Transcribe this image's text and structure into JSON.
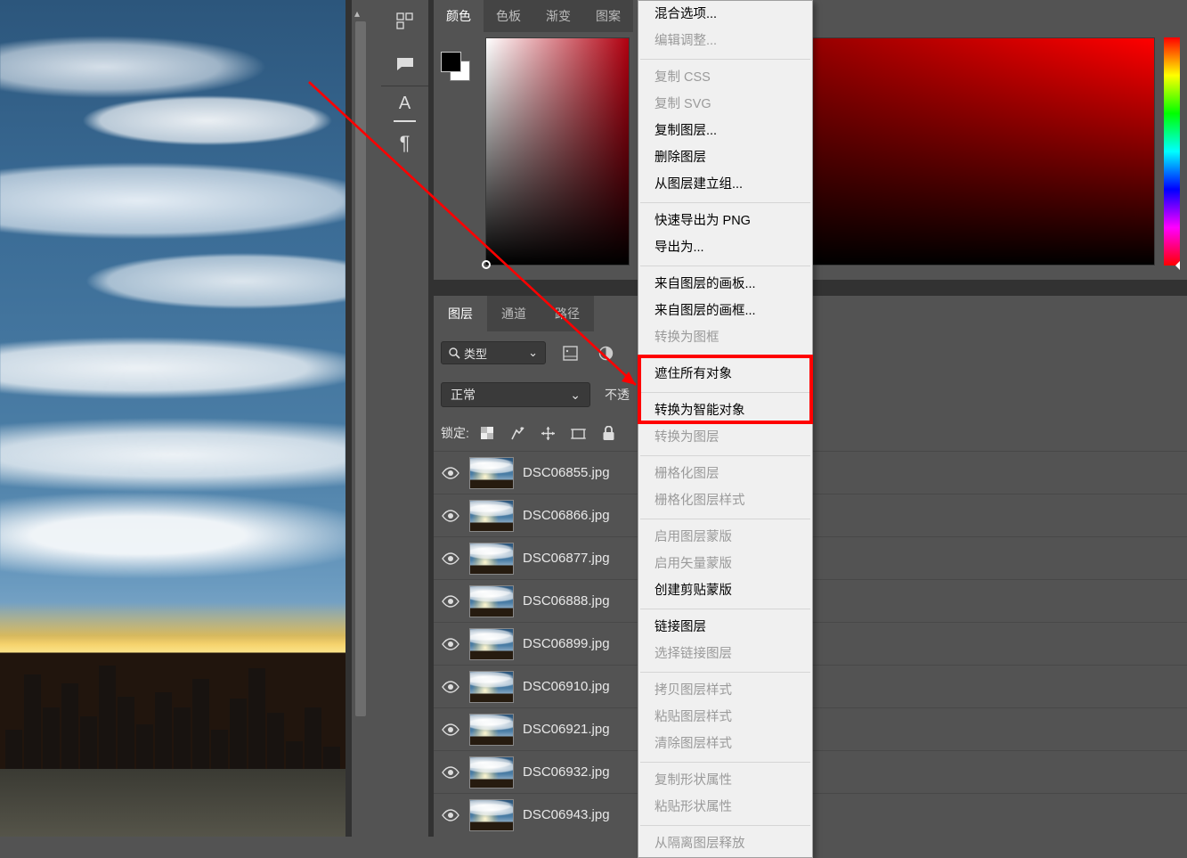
{
  "canvas": {
    "scroll_up_icon": "▴"
  },
  "toolbar_icons": {
    "ruler": "ruler",
    "note": "note",
    "text": "A",
    "paragraph": "¶"
  },
  "color_panel": {
    "tabs": {
      "color": "颜色",
      "swatches": "色板",
      "gradient": "渐变",
      "pattern": "图案"
    },
    "foreground": "#000000",
    "background": "#ffffff"
  },
  "layers_panel": {
    "tabs": {
      "layers": "图层",
      "channels": "通道",
      "paths": "路径"
    },
    "filter": {
      "kind_placeholder": "类型"
    },
    "blend": {
      "mode": "正常",
      "opacity_label": "不透"
    },
    "lock": {
      "label": "锁定:"
    },
    "items": [
      {
        "name": "DSC06855.jpg",
        "visible": true
      },
      {
        "name": "DSC06866.jpg",
        "visible": true
      },
      {
        "name": "DSC06877.jpg",
        "visible": true
      },
      {
        "name": "DSC06888.jpg",
        "visible": true
      },
      {
        "name": "DSC06899.jpg",
        "visible": true
      },
      {
        "name": "DSC06910.jpg",
        "visible": true
      },
      {
        "name": "DSC06921.jpg",
        "visible": true
      },
      {
        "name": "DSC06932.jpg",
        "visible": true
      },
      {
        "name": "DSC06943.jpg",
        "visible": true
      }
    ]
  },
  "context_menu": {
    "groups": [
      [
        {
          "label": "混合选项...",
          "enabled": true
        },
        {
          "label": "编辑调整...",
          "enabled": false
        }
      ],
      [
        {
          "label": "复制 CSS",
          "enabled": false
        },
        {
          "label": "复制 SVG",
          "enabled": false
        },
        {
          "label": "复制图层...",
          "enabled": true
        },
        {
          "label": "删除图层",
          "enabled": true
        },
        {
          "label": "从图层建立组...",
          "enabled": true
        }
      ],
      [
        {
          "label": "快速导出为 PNG",
          "enabled": true
        },
        {
          "label": "导出为...",
          "enabled": true
        }
      ],
      [
        {
          "label": "来自图层的画板...",
          "enabled": true
        },
        {
          "label": "来自图层的画框...",
          "enabled": true
        },
        {
          "label": "转换为图框",
          "enabled": false
        }
      ],
      [
        {
          "label": "遮住所有对象",
          "enabled": true
        }
      ],
      [
        {
          "label": "转换为智能对象",
          "enabled": true,
          "highlight": true
        },
        {
          "label": "转换为图层",
          "enabled": false
        }
      ],
      [
        {
          "label": "栅格化图层",
          "enabled": false
        },
        {
          "label": "栅格化图层样式",
          "enabled": false
        }
      ],
      [
        {
          "label": "启用图层蒙版",
          "enabled": false
        },
        {
          "label": "启用矢量蒙版",
          "enabled": false
        },
        {
          "label": "创建剪贴蒙版",
          "enabled": true
        }
      ],
      [
        {
          "label": "链接图层",
          "enabled": true
        },
        {
          "label": "选择链接图层",
          "enabled": false
        }
      ],
      [
        {
          "label": "拷贝图层样式",
          "enabled": false
        },
        {
          "label": "粘贴图层样式",
          "enabled": false
        },
        {
          "label": "清除图层样式",
          "enabled": false
        }
      ],
      [
        {
          "label": "复制形状属性",
          "enabled": false
        },
        {
          "label": "粘贴形状属性",
          "enabled": false
        }
      ],
      [
        {
          "label": "从隔离图层释放",
          "enabled": false
        }
      ]
    ]
  }
}
